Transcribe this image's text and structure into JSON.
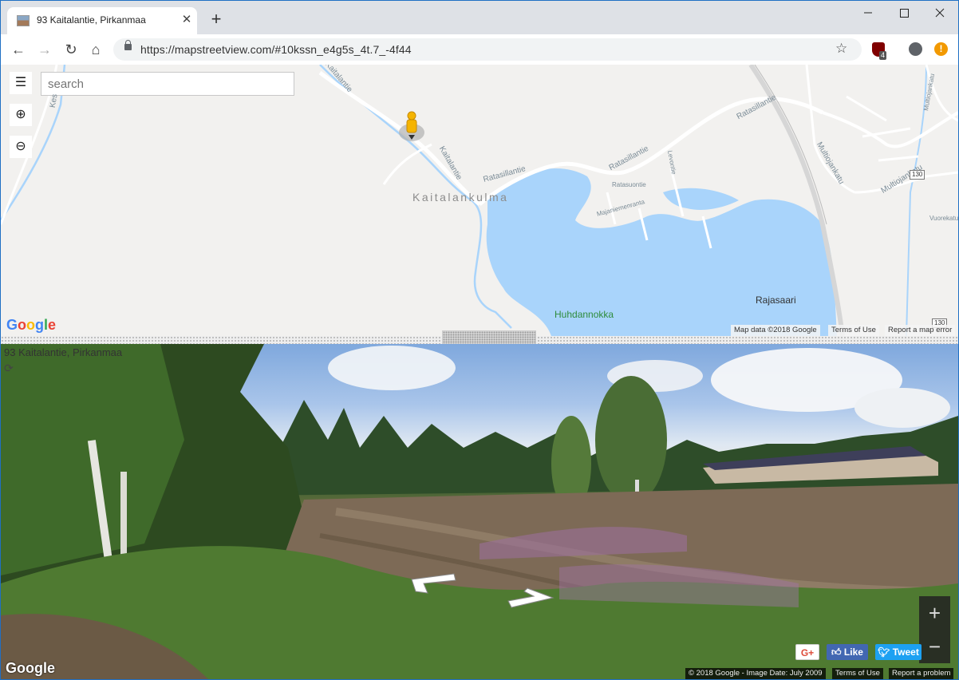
{
  "browser": {
    "tab_title": "93 Kaitalantie, Pirkanmaa",
    "tab_close": "✕",
    "new_tab": "+",
    "url": "https://mapstreetview.com/#10kssn_e4g5s_4t.7_-4f44",
    "extension_badge": "4",
    "alert_glyph": "!",
    "window_controls": {
      "minimize": "—",
      "maximize": "☐",
      "close": "✕"
    },
    "nav": {
      "back": "←",
      "forward": "→",
      "reload": "↻",
      "home": "⌂",
      "star": "☆"
    }
  },
  "map": {
    "menu_glyph": "☰",
    "zoom_in_glyph": "⊕",
    "zoom_out_glyph": "⊖",
    "search_placeholder": "search",
    "place_labels": {
      "kaitalankulma": "Kaitalankulma",
      "huhdannokka": "Huhdannokka",
      "rajasaari": "Rajasaari"
    },
    "road_labels": {
      "kaitalantie_top": "Kaitalantie",
      "kaitalantie_mid": "Kaitalantie",
      "ratasillantie_left": "Ratasillantie",
      "ratasillantie_mid": "Ratasillantie",
      "ratasillantie_right": "Ratasillantie",
      "ratasuontie": "Ratasuontie",
      "majaniemenranta": "Majaniemenranta",
      "levontie": "Levontie",
      "multiojankatu_a": "Multiojankatu",
      "multiojankatu_b": "Multiojankatu",
      "multiojankatu_c": "Multiojankatu",
      "vuorekatu": "Vuorekatu",
      "kes": "Kes"
    },
    "road_numbers": [
      "130",
      "130"
    ],
    "footer": {
      "map_data": "Map data ©2018 Google",
      "terms": "Terms of Use",
      "report": "Report a map error"
    },
    "logo": "Google"
  },
  "streetview": {
    "address": "93 Kaitalantie, Pirkanmaa",
    "compass_glyph": "⟳",
    "zoom_in": "+",
    "zoom_out": "−",
    "share": {
      "gplus": "G+",
      "like": "Like",
      "tweet": "Tweet"
    },
    "footer": {
      "copyright": "© 2018 Google - Image Date: July 2009",
      "terms": "Terms of Use",
      "report": "Report a problem"
    },
    "logo": "Google"
  }
}
